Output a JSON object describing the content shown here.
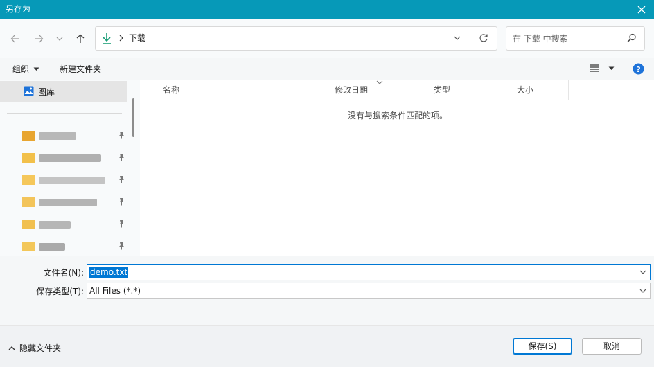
{
  "window": {
    "title": "另存为"
  },
  "address": {
    "path": "下载",
    "search_placeholder": "在 下载 中搜索"
  },
  "commands": {
    "organize": "组织",
    "new_folder": "新建文件夹"
  },
  "nav": {
    "selected": "图库",
    "quick_access_colors": [
      "#e8a530",
      "#f2c04a",
      "#f5c75a",
      "#f3c45a",
      "#f1c050",
      "#f3c75a"
    ]
  },
  "columns": {
    "name": "名称",
    "modified": "修改日期",
    "type": "类型",
    "size": "大小"
  },
  "list": {
    "empty_message": "没有与搜索条件匹配的项。"
  },
  "form": {
    "filename_label": "文件名(N):",
    "filename_value": "demo.txt",
    "filetype_label": "保存类型(T):",
    "filetype_value": "All Files (*.*)"
  },
  "footer": {
    "hide_folders": "隐藏文件夹",
    "save": "保存(S)",
    "cancel": "取消"
  },
  "colors": {
    "titlebar": "#0699b8",
    "accent": "#0078d4",
    "download_icon": "#1b9e77"
  }
}
